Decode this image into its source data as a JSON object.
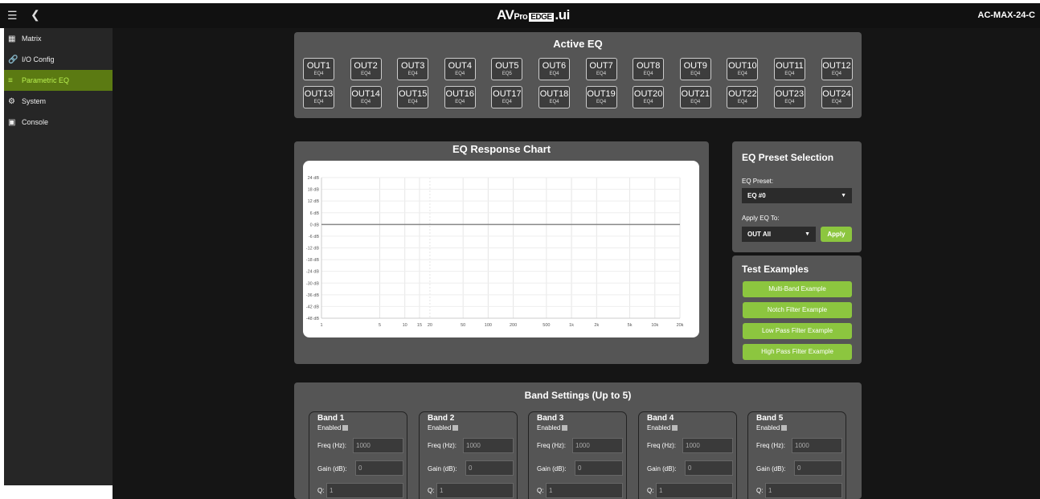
{
  "topbar": {
    "menu_icon": "hamburger-icon",
    "back_icon": "chevron-left-icon",
    "logo_part1": "AV",
    "logo_part2": "Pro",
    "logo_part3": "EDGE",
    "logo_part4": ".ui",
    "device": "AC-MAX-24-C"
  },
  "sidebar": {
    "items": [
      {
        "label": "Matrix",
        "icon": "grid-icon"
      },
      {
        "label": "I/O Config",
        "icon": "link-icon"
      },
      {
        "label": "Parametric EQ",
        "icon": "sliders-icon",
        "active": true
      },
      {
        "label": "System",
        "icon": "gear-icon"
      },
      {
        "label": "Console",
        "icon": "terminal-icon"
      }
    ]
  },
  "active_eq": {
    "title": "Active EQ",
    "outputs": [
      {
        "name": "OUT1",
        "eq": "EQ4"
      },
      {
        "name": "OUT2",
        "eq": "EQ4"
      },
      {
        "name": "OUT3",
        "eq": "EQ4"
      },
      {
        "name": "OUT4",
        "eq": "EQ4"
      },
      {
        "name": "OUT5",
        "eq": "EQ5"
      },
      {
        "name": "OUT6",
        "eq": "EQ4"
      },
      {
        "name": "OUT7",
        "eq": "EQ4"
      },
      {
        "name": "OUT8",
        "eq": "EQ4"
      },
      {
        "name": "OUT9",
        "eq": "EQ4"
      },
      {
        "name": "OUT10",
        "eq": "EQ4"
      },
      {
        "name": "OUT11",
        "eq": "EQ4"
      },
      {
        "name": "OUT12",
        "eq": "EQ4"
      },
      {
        "name": "OUT13",
        "eq": "EQ4"
      },
      {
        "name": "OUT14",
        "eq": "EQ4"
      },
      {
        "name": "OUT15",
        "eq": "EQ4"
      },
      {
        "name": "OUT16",
        "eq": "EQ4"
      },
      {
        "name": "OUT17",
        "eq": "EQ4"
      },
      {
        "name": "OUT18",
        "eq": "EQ4"
      },
      {
        "name": "OUT19",
        "eq": "EQ4"
      },
      {
        "name": "OUT20",
        "eq": "EQ4"
      },
      {
        "name": "OUT21",
        "eq": "EQ4"
      },
      {
        "name": "OUT22",
        "eq": "EQ4"
      },
      {
        "name": "OUT23",
        "eq": "EQ4"
      },
      {
        "name": "OUT24",
        "eq": "EQ4"
      }
    ]
  },
  "chart_panel": {
    "title": "EQ Response Chart"
  },
  "chart_data": {
    "type": "line",
    "title": "EQ Response Chart",
    "x_scale": "log",
    "x_ticks": [
      1,
      5,
      10,
      15,
      20,
      50,
      100,
      200,
      500,
      1000,
      2000,
      5000,
      10000,
      20000
    ],
    "x_tick_labels": [
      "1",
      "5",
      "10",
      "15",
      "20",
      "50",
      "100",
      "200",
      "500",
      "1k",
      "2k",
      "5k",
      "10k",
      "20k"
    ],
    "y_ticks": [
      24,
      18,
      12,
      6,
      0,
      -6,
      -12,
      -18,
      -24,
      -30,
      -36,
      -42,
      -48
    ],
    "y_tick_labels": [
      "24 dB",
      "18 dB",
      "12 dB",
      "6 dB",
      "0 dB",
      "-6 dB",
      "-12 dB",
      "-18 dB",
      "-24 dB",
      "-30 dB",
      "-36 dB",
      "-42 dB",
      "-48 dB"
    ],
    "ylim": [
      -48,
      24
    ],
    "grid": true,
    "series": [
      {
        "x": [
          1,
          20000
        ],
        "y": [
          0,
          0
        ],
        "color": "#888888"
      }
    ]
  },
  "preset": {
    "title": "EQ Preset Selection",
    "preset_label": "EQ Preset:",
    "preset_value": "EQ #0",
    "apply_to_label": "Apply EQ To:",
    "apply_to_value": "OUT All",
    "apply_button": "Apply"
  },
  "tests": {
    "title": "Test Examples",
    "buttons": [
      "Multi-Band Example",
      "Notch Filter Example",
      "Low Pass Filter Example",
      "High Pass Filter Example"
    ]
  },
  "bands": {
    "title": "Band Settings (Up to 5)",
    "enabled_label": "Enabled",
    "freq_label": "Freq (Hz):",
    "gain_label": "Gain (dB):",
    "q_label": "Q:",
    "items": [
      {
        "name": "Band 1",
        "freq": "1000",
        "gain": "0",
        "q": "1"
      },
      {
        "name": "Band 2",
        "freq": "1000",
        "gain": "0",
        "q": "1"
      },
      {
        "name": "Band 3",
        "freq": "1000",
        "gain": "0",
        "q": "1"
      },
      {
        "name": "Band 4",
        "freq": "1000",
        "gain": "0",
        "q": "1"
      },
      {
        "name": "Band 5",
        "freq": "1000",
        "gain": "0",
        "q": "1"
      }
    ]
  },
  "colors": {
    "accent": "#8cc63f",
    "active_nav_bg": "#5b7a12",
    "panel": "#555555",
    "background": "#151515"
  }
}
